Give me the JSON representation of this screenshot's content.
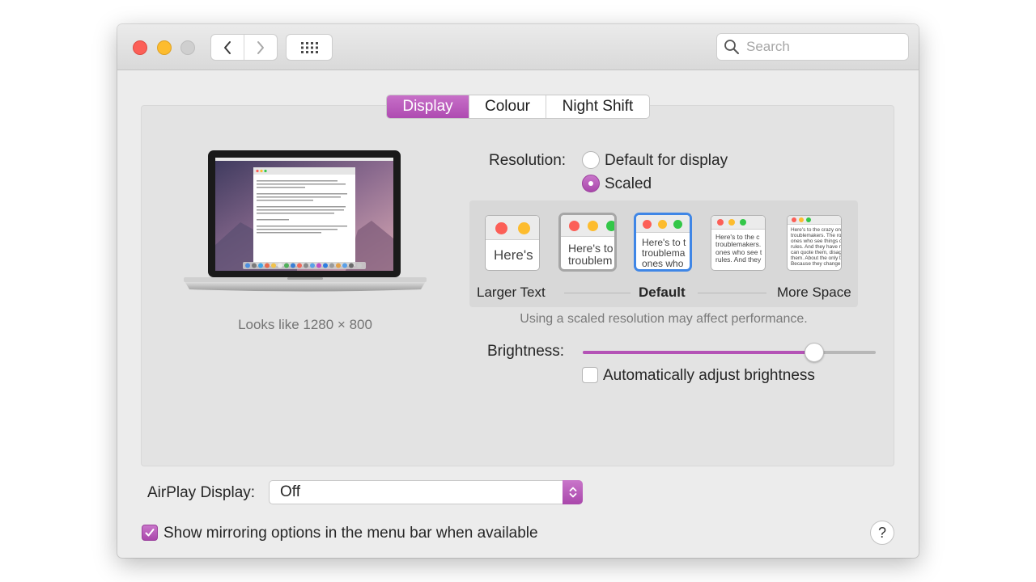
{
  "toolbar": {
    "search_placeholder": "Search",
    "back_icon": "chevron-left-icon",
    "forward_icon": "chevron-right-icon",
    "grid_icon": "grid-icon"
  },
  "tabs": [
    {
      "label": "Display",
      "active": true
    },
    {
      "label": "Colour",
      "active": false
    },
    {
      "label": "Night Shift",
      "active": false
    }
  ],
  "display": {
    "looks_like": "Looks like 1280 × 800",
    "resolution_label": "Resolution:",
    "options": [
      {
        "label": "Default for display",
        "selected": false
      },
      {
        "label": "Scaled",
        "selected": true
      }
    ],
    "scale": {
      "left_label": "Larger Text",
      "center_label": "Default",
      "right_label": "More Space",
      "selected_index": 2,
      "thumbs": [
        {
          "text": "Here's"
        },
        {
          "text": "Here's to\ntroublem"
        },
        {
          "text": "Here's to t\ntroublema\nones who"
        },
        {
          "text": "Here's to the c\ntroublemakers.\nones who see t\nrules. And they"
        },
        {
          "text": "Here's to the crazy one\ntroublemakers. The rou\nones who see things dif\nrules. And they have no\ncan quote them, disagre\nthem. About the only th\nBecause they change th"
        }
      ]
    },
    "hint": "Using a scaled resolution may affect performance.",
    "brightness_label": "Brightness:",
    "brightness_level": 0.79,
    "auto_brightness_label": "Automatically adjust brightness",
    "auto_brightness_checked": false
  },
  "airplay": {
    "label": "AirPlay Display:",
    "value": "Off"
  },
  "mirroring": {
    "label": "Show mirroring options in the menu bar when available",
    "checked": true
  },
  "help_label": "?",
  "colors": {
    "accent": "#b453b6",
    "close": "#fc5f57",
    "minimize": "#fdbc2e",
    "selected_outline": "#3f86e6"
  }
}
